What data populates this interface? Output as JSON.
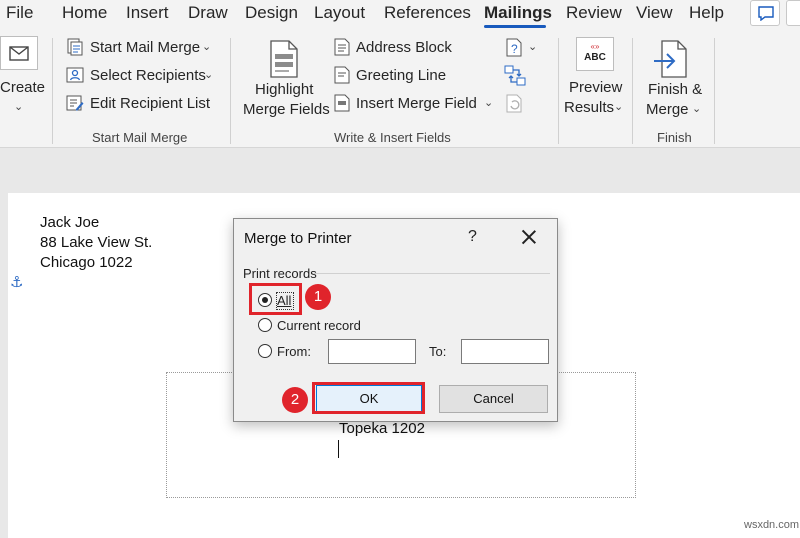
{
  "tabs": [
    {
      "label": "File"
    },
    {
      "label": "Home"
    },
    {
      "label": "Insert"
    },
    {
      "label": "Draw"
    },
    {
      "label": "Design"
    },
    {
      "label": "Layout"
    },
    {
      "label": "References"
    },
    {
      "label": "Mailings",
      "active": true
    },
    {
      "label": "Review"
    },
    {
      "label": "View"
    },
    {
      "label": "Help"
    }
  ],
  "ribbon": {
    "create": {
      "label": "Create",
      "icon": "envelope-icon"
    },
    "start_group": {
      "label": "Start Mail Merge",
      "items": [
        {
          "label": "Start Mail Merge",
          "icon": "start-mail-merge-icon"
        },
        {
          "label": "Select Recipients",
          "icon": "select-recipients-icon"
        },
        {
          "label": "Edit Recipient List",
          "icon": "edit-recipient-list-icon"
        }
      ]
    },
    "write_group": {
      "label": "Write & Insert Fields",
      "highlight_line1": "Highlight",
      "highlight_line2": "Merge Fields",
      "items": [
        {
          "label": "Address Block",
          "icon": "address-block-icon"
        },
        {
          "label": "Greeting Line",
          "icon": "greeting-line-icon"
        },
        {
          "label": "Insert Merge Field",
          "icon": "insert-merge-field-icon"
        }
      ]
    },
    "preview": {
      "line1": "Preview",
      "line2": "Results",
      "icon_text": "ABC",
      "icon_top": "«»"
    },
    "finish": {
      "line1": "Finish &",
      "line2": "Merge",
      "group_label": "Finish"
    }
  },
  "document": {
    "address": [
      "Jack Joe",
      "88 Lake View St.",
      "Chicago 1022"
    ],
    "second_city": "Topeka 1202"
  },
  "dialog": {
    "title": "Merge to Printer",
    "help": "?",
    "group_label": "Print records",
    "options": {
      "all": "All",
      "current": "Current record",
      "from": "From:",
      "to": "To:"
    },
    "from_value": "",
    "to_value": "",
    "ok": "OK",
    "cancel": "Cancel"
  },
  "annotations": {
    "step1": "1",
    "step2": "2"
  },
  "watermark": "wsxdn.com",
  "colors": {
    "accent": "#185abd",
    "annotation": "#e0242b",
    "ok_border": "#0078d7"
  }
}
